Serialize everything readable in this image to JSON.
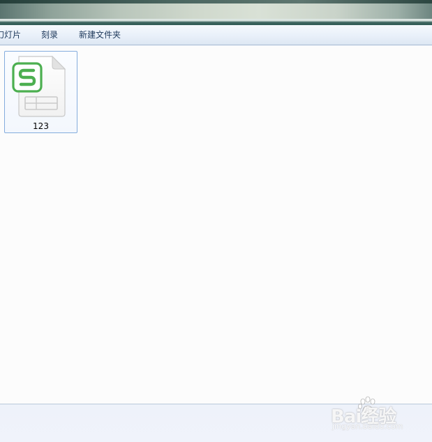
{
  "toolbar": {
    "slideshow_label": "幻灯片",
    "burn_label": "刻录",
    "new_folder_label": "新建文件夹"
  },
  "files": [
    {
      "name": "123",
      "icon": "wps-spreadsheet-icon",
      "selected": true,
      "accent_color": "#4caf50"
    }
  ],
  "watermark": {
    "brand": "Bai经验",
    "url": "jingyan.baidu.com"
  },
  "colors": {
    "toolbar_text": "#1e395b",
    "selection_border": "#84acdd",
    "content_bg": "#fcfcfc"
  }
}
